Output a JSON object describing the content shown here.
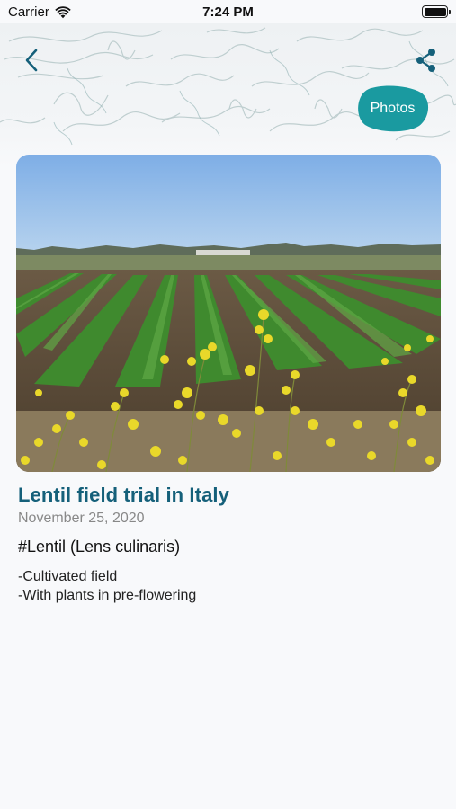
{
  "status_bar": {
    "carrier": "Carrier",
    "time": "7:24 PM",
    "battery_level": 1.0
  },
  "header": {
    "back_icon": "chevron-left-icon",
    "share_icon": "share-icon",
    "photos_label": "Photos",
    "accent_color": "#1a9aa0"
  },
  "observation": {
    "photo_description_icon": "field-photo",
    "title": "Lentil field trial in Italy",
    "date": "November 25, 2020",
    "species": "#Lentil (Lens culinaris)",
    "notes": [
      "-Cultivated field",
      "-With plants in pre-flowering"
    ]
  },
  "colors": {
    "title": "#15607a",
    "date": "#888888",
    "background": "#f8f9fb"
  }
}
